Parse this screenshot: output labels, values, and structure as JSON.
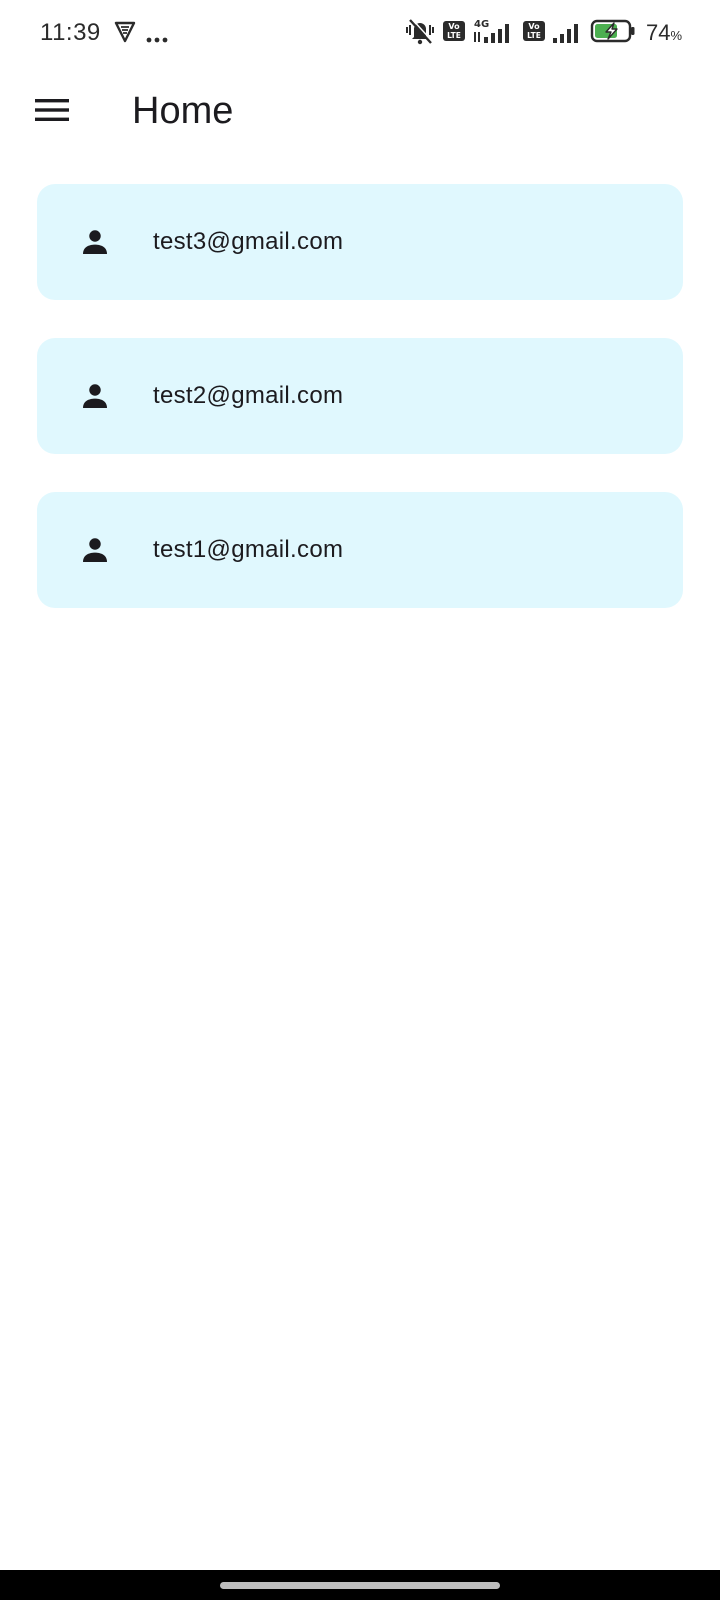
{
  "status_bar": {
    "time": "11:39",
    "battery_percent": "74",
    "battery_unit": "%",
    "icons": [
      "vpn-shield-icon",
      "more-dots-icon",
      "vibrate-icon",
      "volte-icon",
      "signal-4g-icon",
      "volte-icon",
      "signal-icon",
      "battery-charging-icon"
    ]
  },
  "app_bar": {
    "title": "Home",
    "menu_icon": "hamburger-menu-icon"
  },
  "users": [
    {
      "email": "test3@gmail.com",
      "icon": "person-icon"
    },
    {
      "email": "test2@gmail.com",
      "icon": "person-icon"
    },
    {
      "email": "test1@gmail.com",
      "icon": "person-icon"
    }
  ],
  "colors": {
    "card_background": "#e0f8fe",
    "text": "#1c1b1f",
    "battery_accent": "#4caf50"
  }
}
